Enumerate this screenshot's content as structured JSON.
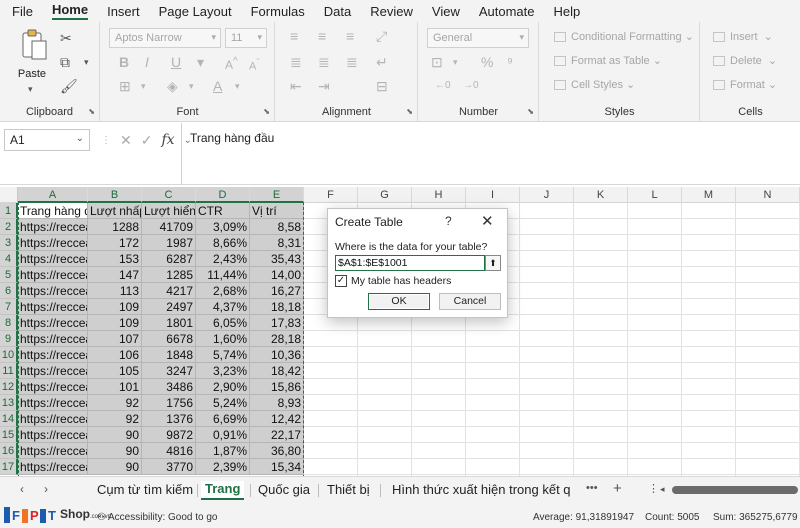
{
  "menu": [
    "File",
    "Home",
    "Insert",
    "Page Layout",
    "Formulas",
    "Data",
    "Review",
    "View",
    "Automate",
    "Help"
  ],
  "ribbon": {
    "clipboard": {
      "label": "Clipboard",
      "paste": "Paste"
    },
    "font": {
      "label": "Font",
      "font_name": "Aptos Narrow",
      "font_size": "11"
    },
    "alignment": {
      "label": "Alignment"
    },
    "number": {
      "label": "Number",
      "format": "General"
    },
    "styles": {
      "label": "Styles",
      "conditional": "Conditional Formatting",
      "format_table": "Format as Table",
      "cell_styles": "Cell Styles"
    },
    "cells": {
      "label": "Cells",
      "insert": "Insert",
      "delete": "Delete",
      "format": "Format"
    }
  },
  "formula_bar": {
    "name_box": "A1",
    "content": "Trang hàng đầu"
  },
  "columns": [
    "A",
    "B",
    "C",
    "D",
    "E",
    "F",
    "G",
    "H",
    "I",
    "J",
    "K",
    "L",
    "M",
    "N"
  ],
  "rows": [
    {
      "n": "1",
      "a": "Trang hàng đầ",
      "b": "Lượt nhấp",
      "c": "Lượt hiển t",
      "d": "CTR",
      "e": "Vị trí"
    },
    {
      "n": "2",
      "a": "https://reccea",
      "b": "1288",
      "c": "41709",
      "d": "3,09%",
      "e": "8,58"
    },
    {
      "n": "3",
      "a": "https://reccea",
      "b": "172",
      "c": "1987",
      "d": "8,66%",
      "e": "8,31"
    },
    {
      "n": "4",
      "a": "https://reccea",
      "b": "153",
      "c": "6287",
      "d": "2,43%",
      "e": "35,43"
    },
    {
      "n": "5",
      "a": "https://reccea",
      "b": "147",
      "c": "1285",
      "d": "11,44%",
      "e": "14,00"
    },
    {
      "n": "6",
      "a": "https://reccea",
      "b": "113",
      "c": "4217",
      "d": "2,68%",
      "e": "16,27"
    },
    {
      "n": "7",
      "a": "https://reccea",
      "b": "109",
      "c": "2497",
      "d": "4,37%",
      "e": "18,18"
    },
    {
      "n": "8",
      "a": "https://reccea",
      "b": "109",
      "c": "1801",
      "d": "6,05%",
      "e": "17,83"
    },
    {
      "n": "9",
      "a": "https://reccea",
      "b": "107",
      "c": "6678",
      "d": "1,60%",
      "e": "28,18"
    },
    {
      "n": "10",
      "a": "https://reccea",
      "b": "106",
      "c": "1848",
      "d": "5,74%",
      "e": "10,36"
    },
    {
      "n": "11",
      "a": "https://reccea",
      "b": "105",
      "c": "3247",
      "d": "3,23%",
      "e": "18,42"
    },
    {
      "n": "12",
      "a": "https://reccea",
      "b": "101",
      "c": "3486",
      "d": "2,90%",
      "e": "15,86"
    },
    {
      "n": "13",
      "a": "https://reccea",
      "b": "92",
      "c": "1756",
      "d": "5,24%",
      "e": "8,93"
    },
    {
      "n": "14",
      "a": "https://reccea",
      "b": "92",
      "c": "1376",
      "d": "6,69%",
      "e": "12,42"
    },
    {
      "n": "15",
      "a": "https://reccea",
      "b": "90",
      "c": "9872",
      "d": "0,91%",
      "e": "22,17"
    },
    {
      "n": "16",
      "a": "https://reccea",
      "b": "90",
      "c": "4816",
      "d": "1,87%",
      "e": "36,80"
    },
    {
      "n": "17",
      "a": "https://reccea",
      "b": "90",
      "c": "3770",
      "d": "2,39%",
      "e": "15,34"
    }
  ],
  "dialog": {
    "title": "Create Table",
    "help": "?",
    "close": "✕",
    "prompt": "Where is the data for your table?",
    "range": "$A$1:$E$1001",
    "headers_label": "My table has headers",
    "headers_checked": "✓",
    "ok": "OK",
    "cancel": "Cancel"
  },
  "sheet_tabs": [
    "Cụm từ tìm kiếm",
    "Trang",
    "Quốc gia",
    "Thiết bị",
    "Hình thức xuất hiện trong kết q"
  ],
  "active_tab": "Trang",
  "tab_more": "•••",
  "tab_add": "+",
  "status": {
    "accessibility": "Accessibility: Good to go",
    "average": "Average: 91,31891947",
    "count": "Count: 5005",
    "sum": "Sum: 365275,6779"
  },
  "logo": {
    "brand": "FPT",
    "shop": "Shop",
    "suffix": ".com.vn"
  },
  "colors": {
    "accent": "#217346",
    "selection": "#cfcfcf",
    "logo_blue": "#1b5bb0",
    "logo_orange": "#f07522",
    "logo_red": "#e02020"
  }
}
